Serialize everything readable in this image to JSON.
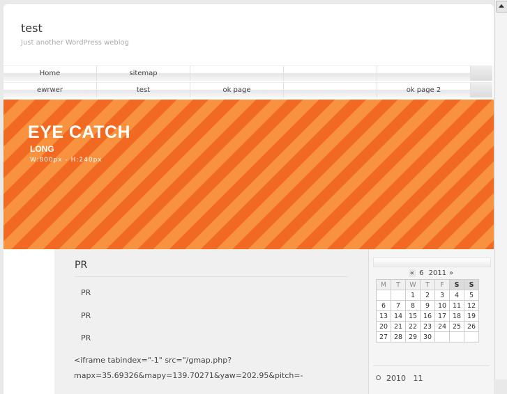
{
  "site": {
    "title": "test",
    "description": "Just another WordPress weblog"
  },
  "nav": {
    "row1": [
      "Home",
      "sitemap",
      "",
      "",
      ""
    ],
    "row2": [
      "ewrwer",
      "test",
      "ok page",
      "",
      "ok page 2"
    ]
  },
  "banner": {
    "title": "EYE CATCH",
    "subtitle": "LONG",
    "size": "W:800px - H:240px",
    "accent_color": "#f26a22"
  },
  "post": {
    "title": "PR",
    "lines": [
      "PR",
      "PR",
      "PR"
    ],
    "iframe_line1": "<iframe tabindex=\"-1\" src=\"/gmap.php?",
    "iframe_line2": "mapx=35.69326&mapy=139.70271&yaw=202.95&pitch=-"
  },
  "calendar": {
    "prev": "«",
    "month": "6",
    "year": "2011",
    "next": "»",
    "weekdays": [
      "M",
      "T",
      "W",
      "T",
      "F",
      "S",
      "S"
    ],
    "weeks": [
      [
        "",
        "",
        "1",
        "2",
        "3",
        "4",
        "5"
      ],
      [
        "6",
        "7",
        "8",
        "9",
        "10",
        "11",
        "12"
      ],
      [
        "13",
        "14",
        "15",
        "16",
        "17",
        "18",
        "19"
      ],
      [
        "20",
        "21",
        "22",
        "23",
        "24",
        "25",
        "26"
      ],
      [
        "27",
        "28",
        "29",
        "30",
        "",
        "",
        ""
      ]
    ]
  },
  "archives": [
    {
      "year": "2010",
      "month": "11"
    }
  ]
}
